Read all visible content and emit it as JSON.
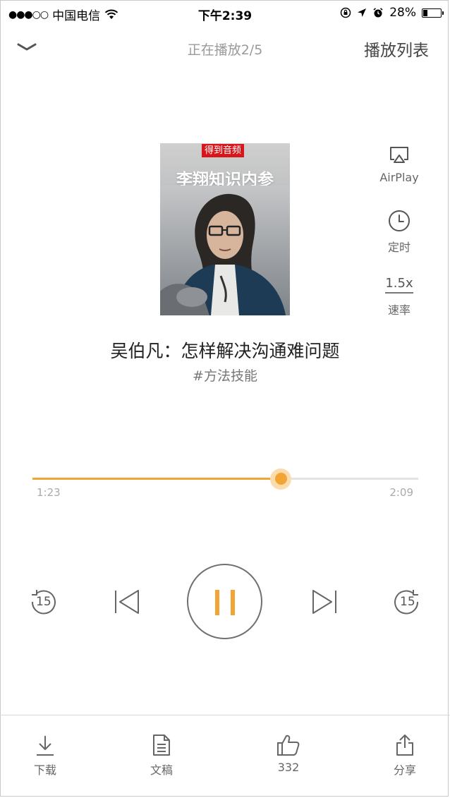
{
  "status_bar": {
    "signal": "●●●○○",
    "carrier": "中国电信",
    "time": "下午2:39",
    "battery_percent": "28%",
    "battery_level": 0.28
  },
  "nav": {
    "title": "正在播放2/5",
    "playlist_label": "播放列表"
  },
  "cover": {
    "tag": "得到音频",
    "title": "李翔知识内参"
  },
  "side_actions": {
    "airplay_label": "AirPlay",
    "timer_label": "定时",
    "speed_value": "1.5x",
    "speed_label": "速率"
  },
  "track": {
    "title": "吴伯凡：怎样解决沟通难问题",
    "tag": "#方法技能"
  },
  "progress": {
    "elapsed": "1:23",
    "total": "2:09",
    "fraction": 0.643
  },
  "controls": {
    "rewind_seconds": "15",
    "forward_seconds": "15"
  },
  "tabs": {
    "download": "下载",
    "transcript": "文稿",
    "like_count": "332",
    "share": "分享"
  },
  "colors": {
    "accent": "#f2a535",
    "cover_tag_red": "#d7161c",
    "icon_gray": "#707070"
  }
}
